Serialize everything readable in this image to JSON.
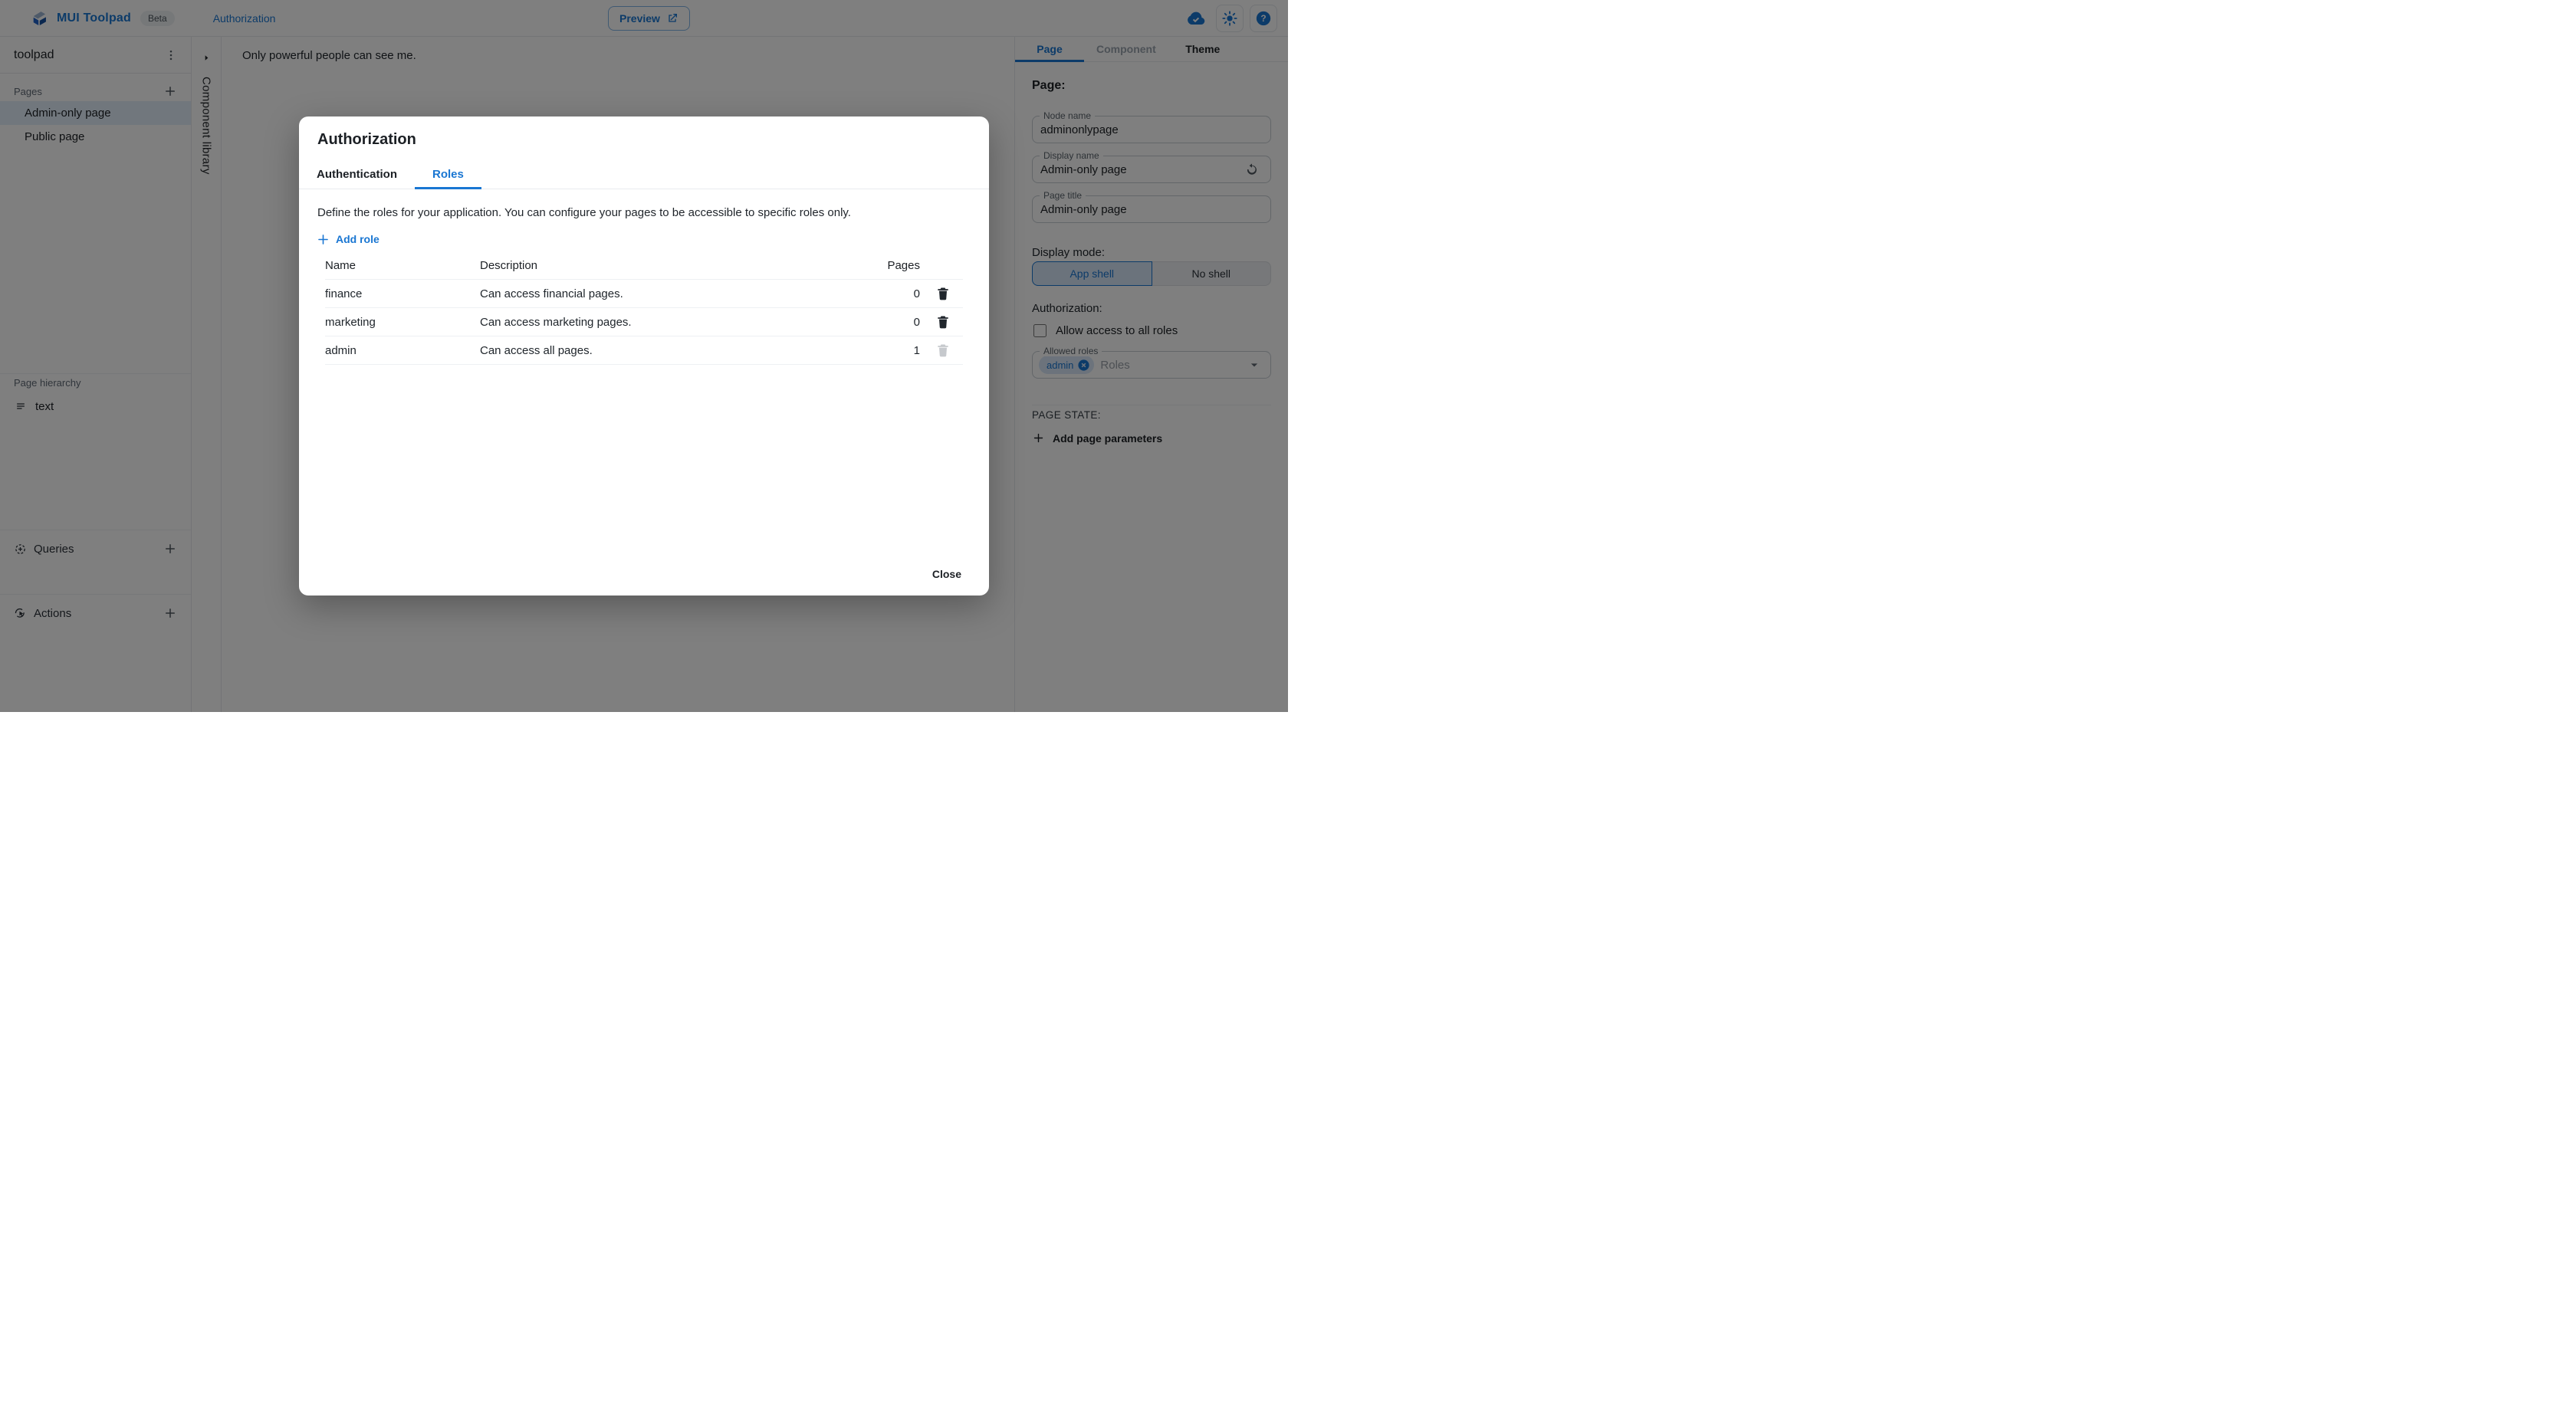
{
  "colors": {
    "primary": "#1976d2",
    "text": "#1c2025",
    "selected_item_bg": "#e3eefa"
  },
  "icons": {
    "mui-logo": "stacked-blue-blocks",
    "kebab-icon": "vertical-dots",
    "plus-icon": "plus",
    "chevron-right-icon": "right-triangle",
    "text-lines-icon": "three-lines",
    "queries-icon": "dashed-circle-plus",
    "actions-icon": "cursor-in-circle",
    "external-link-icon": "box-arrow",
    "cloud-check-icon": "cloud-with-check",
    "brightness-icon": "sun",
    "help-icon": "question-circle",
    "trash-icon": "trash-can",
    "reset-icon": "circular-arrow",
    "caret-down-icon": "down-triangle",
    "chip-close-icon": "x-circle"
  },
  "header": {
    "app_name": "MUI Toolpad",
    "beta_label": "Beta",
    "breadcrumb": "Authorization",
    "preview_label": "Preview"
  },
  "sidebar": {
    "project_name": "toolpad",
    "pages_section": "Pages",
    "pages": [
      {
        "label": "Admin-only page"
      },
      {
        "label": "Public page"
      }
    ],
    "hierarchy_section": "Page hierarchy",
    "hierarchy_items": [
      {
        "label": "text"
      }
    ],
    "queries_section": "Queries",
    "actions_section": "Actions"
  },
  "component_library": {
    "label": "Component library"
  },
  "canvas": {
    "text": "Only powerful people can see me."
  },
  "dialog": {
    "title": "Authorization",
    "tabs": [
      {
        "label": "Authentication"
      },
      {
        "label": "Roles"
      }
    ],
    "description": "Define the roles for your application. You can configure your pages to be accessible to specific roles only.",
    "add_role_label": "Add role",
    "table": {
      "headers": {
        "name": "Name",
        "description": "Description",
        "pages": "Pages"
      },
      "rows": [
        {
          "name": "finance",
          "description": "Can access financial pages.",
          "pages": "0"
        },
        {
          "name": "marketing",
          "description": "Can access marketing pages.",
          "pages": "0"
        },
        {
          "name": "admin",
          "description": "Can access all pages.",
          "pages": "1"
        }
      ]
    },
    "close_label": "Close"
  },
  "inspector": {
    "tabs": [
      {
        "label": "Page"
      },
      {
        "label": "Component"
      },
      {
        "label": "Theme"
      }
    ],
    "heading": "Page:",
    "node_name": {
      "label": "Node name",
      "value": "adminonlypage"
    },
    "display_name": {
      "label": "Display name",
      "value": "Admin-only page"
    },
    "page_title": {
      "label": "Page title",
      "value": "Admin-only page"
    },
    "display_mode": {
      "heading": "Display mode:",
      "options": [
        {
          "label": "App shell"
        },
        {
          "label": "No shell"
        }
      ]
    },
    "authorization": {
      "heading": "Authorization:",
      "checkbox_label": "Allow access to all roles",
      "allowed_roles": {
        "label": "Allowed roles",
        "chip": "admin",
        "placeholder": "Roles"
      }
    },
    "page_state": {
      "heading": "PAGE STATE:",
      "add_label": "Add page parameters"
    }
  }
}
